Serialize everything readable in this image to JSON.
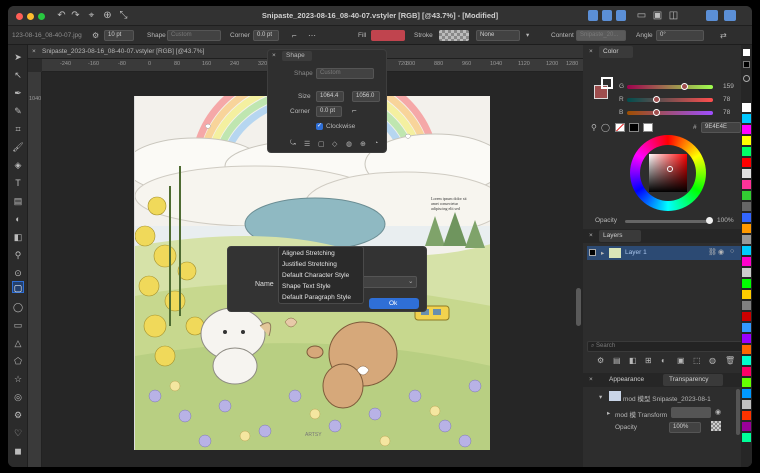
{
  "window": {
    "title": "Snipaste_2023-08-16_08-40-07.vstyler [RGB] [@43.7%] - [Modified]"
  },
  "options_bar": {
    "doc_short": "123-08-16_08-40-07.jpg",
    "stroke_width": "10 pt",
    "shape_label": "Shape",
    "shape_value": "Custom",
    "corner_label": "Corner",
    "corner_value": "0.0 pt",
    "fill_label": "Fill",
    "fill_color": "#c0444e",
    "stroke_label": "Stroke",
    "stroke_style": "None",
    "content_label": "Content",
    "content_value": "Snipaste_20...",
    "angle_label": "Angle",
    "angle_value": "0°"
  },
  "document_tab": {
    "label": "Snipaste_2023-08-16_08-40-07.vstyler [RGB] [@43.7%]"
  },
  "ruler": {
    "ticks": [
      "-240",
      "-160",
      "-80",
      "0",
      "80",
      "160",
      "240",
      "320",
      "400",
      "480",
      "560",
      "640",
      "720",
      "800",
      "880",
      "960",
      "1040",
      "1120",
      "1200",
      "1280"
    ],
    "v_tick": "1040"
  },
  "shape_panel": {
    "title": "Shape",
    "shape_label": "Shape",
    "shape_value": "Custom",
    "size_label": "Size",
    "size_w": "1064.4",
    "size_h": "1056.0",
    "corner_label": "Corner",
    "corner_value": "0.0 pt",
    "clockwise_label": "Clockwise"
  },
  "name_dialog": {
    "name_label": "Name",
    "ok_label": "Ok",
    "options": [
      "Aligned Stretching",
      "Justified Stretching",
      "Default Character Style",
      "Shape Text Style",
      "Default Paragraph Style"
    ]
  },
  "color_panel": {
    "tab": "Color",
    "g_label": "G",
    "r_label": "R",
    "b_label": "B",
    "r_value": "159",
    "g_value": "78",
    "b_value": "78",
    "hex_value": "9E4E4E",
    "opacity_label": "Opacity",
    "opacity_value": "100%",
    "current_color": "#9e4e4e"
  },
  "layers_panel": {
    "tab": "Layers",
    "layer_name": "Layer 1",
    "search_placeholder": "Search"
  },
  "appearance_panel": {
    "tab_appearance": "Appearance",
    "tab_transparency": "Transparency",
    "item1": "mod 模型 Snipaste_2023-08-1",
    "item2": "mod 模 Transform",
    "opacity_label": "Opacity",
    "opacity_value": "100%"
  },
  "artwork": {
    "caption": "Lorem ipsum dolor sit amet consectetur adipiscing elit sed",
    "watermark": "ARTSY"
  },
  "colors": {
    "accent_blue": "#2f6fd6",
    "swatches": [
      "#ffffff",
      "#00c8ff",
      "#ff00ff",
      "#ffff00",
      "#00ff66",
      "#ff0000",
      "#e0e0e0",
      "#ff3399",
      "#33cc33",
      "#666666",
      "#3366ff",
      "#ff9900",
      "#999999",
      "#00ccff",
      "#ff00cc",
      "#cccccc",
      "#00ff00",
      "#ffcc00",
      "#808080",
      "#cc0000",
      "#3399ff",
      "#9900ff",
      "#ff6600",
      "#00ffcc",
      "#ff0066",
      "#66ff00",
      "#0099ff",
      "#c0c0c0",
      "#ff3300",
      "#990099",
      "#00ff99"
    ]
  }
}
